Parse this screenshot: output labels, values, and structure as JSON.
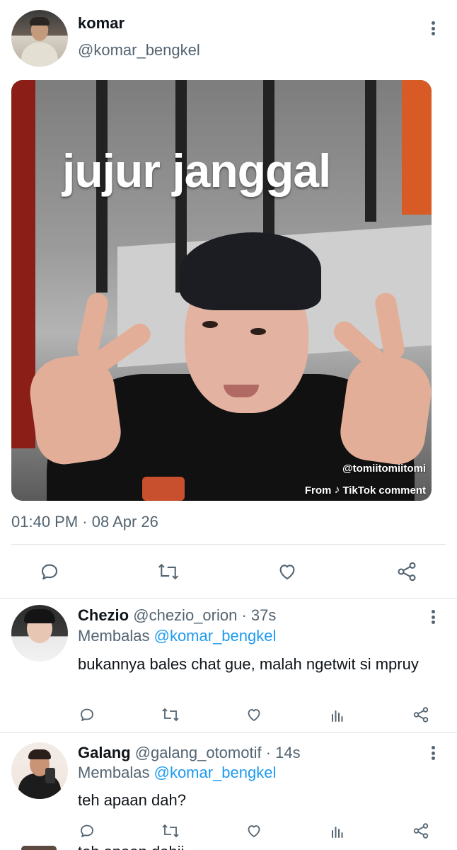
{
  "tweet": {
    "author_name": "komar",
    "author_handle": "@komar_bengkel",
    "media": {
      "caption": "jujur janggal",
      "watermark_handle": "@tomiitomiitomi",
      "watermark_from": "From",
      "watermark_brand": "TikTok",
      "watermark_suffix": "comment"
    },
    "timestamp": "01:40 PM · 08 Apr 26",
    "actions": [
      "reply-icon",
      "retweet-icon",
      "like-icon",
      "share-icon"
    ]
  },
  "replies": [
    {
      "name": "Chezio",
      "handle": "@chezio_orion",
      "time": "· 37s",
      "replying_prefix": "Membalas",
      "replying_to": "@komar_bengkel",
      "text": "bukannya bales chat gue, malah ngetwit si mpruy",
      "actions": [
        "reply-icon",
        "retweet-icon",
        "like-icon",
        "analytics-icon",
        "share-icon"
      ]
    },
    {
      "name": "Galang",
      "handle": "@galang_otomotif",
      "time": "· 14s",
      "replying_prefix": "Membalas",
      "replying_to": "@komar_bengkel",
      "text": "teh apaan dah?",
      "actions": [
        "reply-icon",
        "retweet-icon",
        "like-icon",
        "analytics-icon",
        "share-icon"
      ]
    }
  ],
  "partial_next_reply_text": "teh apaan dahij",
  "colors": {
    "text_primary": "#0f1419",
    "text_secondary": "#536471",
    "link": "#1d9bf0",
    "divider": "#e1e6ea"
  }
}
